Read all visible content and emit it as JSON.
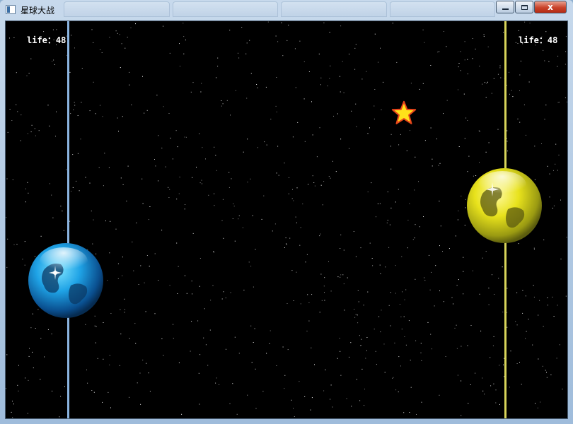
{
  "window": {
    "title": "星球大战",
    "close_symbol": "x"
  },
  "colors": {
    "background": "#000000",
    "left_lane": "#8ab4e0",
    "right_lane": "#d8d45a",
    "left_planet": "#1fa3e6",
    "right_planet": "#e8e21c",
    "star_fill": "#ffe21a",
    "star_outline": "#e8461a"
  },
  "game": {
    "left_player": {
      "life_label": "life：48",
      "planet": "blue-planet-icon"
    },
    "right_player": {
      "life_label": "life：48",
      "planet": "yellow-planet-icon"
    },
    "item": "star-icon"
  }
}
